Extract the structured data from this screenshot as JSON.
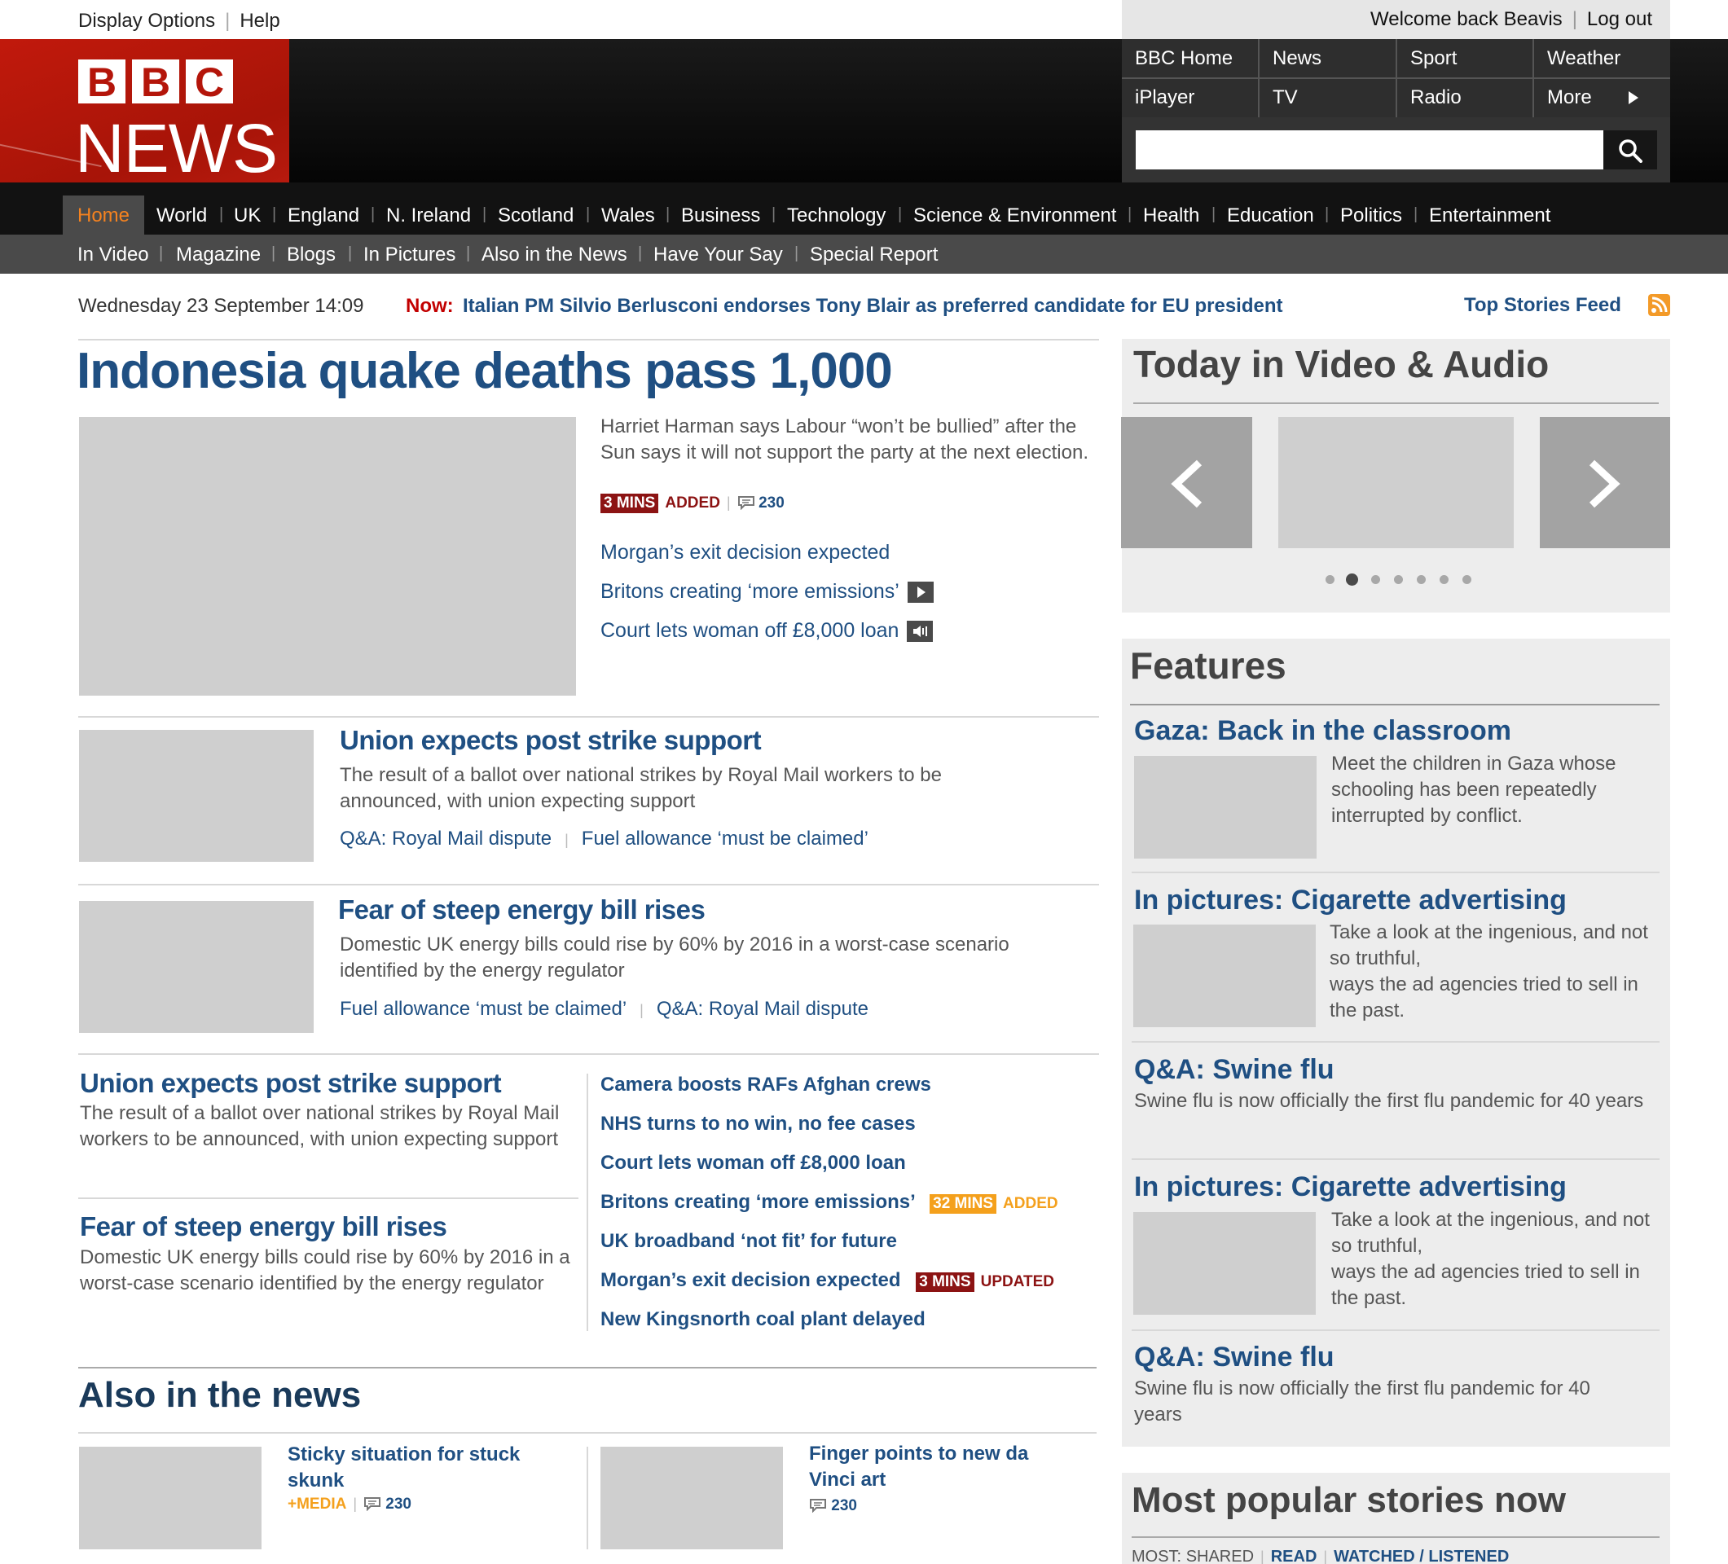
{
  "utility": {
    "display_options": "Display Options",
    "help": "Help",
    "sep": "|",
    "welcome": "Welcome back Beavis",
    "logout": "Log out"
  },
  "logo": {
    "letters": [
      "B",
      "B",
      "C"
    ],
    "news": "NEWS"
  },
  "global_nav": {
    "row1": [
      "BBC Home",
      "News",
      "Sport",
      "Weather"
    ],
    "row2": [
      "iPlayer",
      "TV",
      "Radio",
      "More"
    ]
  },
  "search": {
    "value": "",
    "placeholder": ""
  },
  "primary_nav": [
    "Home",
    "World",
    "UK",
    "England",
    "N. Ireland",
    "Scotland",
    "Wales",
    "Business",
    "Technology",
    "Science & Environment",
    "Health",
    "Education",
    "Politics",
    "Entertainment"
  ],
  "secondary_nav": [
    "In Video",
    "Magazine",
    "Blogs",
    "In Pictures",
    "Also in the News",
    "Have Your Say",
    "Special Report"
  ],
  "ticker": {
    "date": "Wednesday 23 September 14:09",
    "now_label": "Now:",
    "headline": "Italian PM Silvio Berlusconi endorses Tony Blair as preferred candidate for EU president",
    "feed_label": "Top Stories Feed"
  },
  "lead": {
    "title": "Indonesia quake deaths pass 1,000",
    "summary": "Harriet Harman says Labour “won’t be bullied” after the Sun says it will not support the party at the next election.",
    "badge": "3 MINS",
    "tag": "ADDED",
    "comments": "230",
    "related": [
      "Morgan’s exit decision expected",
      "Britons creating ‘more emissions’",
      "Court lets woman off £8,000 loan"
    ]
  },
  "stories": [
    {
      "title": "Union expects post strike support",
      "summary": "The result of a ballot over national strikes by Royal Mail workers to be announced, with union expecting support",
      "links": [
        "Q&A: Royal Mail dispute",
        "Fuel allowance ‘must be claimed’"
      ]
    },
    {
      "title": "Fear of steep energy bill rises",
      "summary": "Domestic UK energy bills could rise by 60% by 2016 in a worst-case scenario identified by the energy regulator",
      "links": [
        "Fuel allowance ‘must be claimed’",
        "Q&A: Royal Mail dispute"
      ]
    }
  ],
  "small_stories": [
    {
      "title": "Union expects post strike support",
      "summary": "The result of a ballot over national strikes by Royal Mail workers to be announced, with union expecting support"
    },
    {
      "title": "Fear of steep energy bill rises",
      "summary": "Domestic UK energy bills could rise by 60% by 2016 in a worst-case scenario identified by the energy regulator"
    }
  ],
  "headline_list": [
    {
      "text": "Camera boosts RAFs Afghan crews"
    },
    {
      "text": "NHS turns to no win, no fee cases"
    },
    {
      "text": "Court lets woman off £8,000 loan"
    },
    {
      "text": "Britons creating ‘more emissions’",
      "badge": "32 MINS",
      "tag": "ADDED",
      "color": "orange"
    },
    {
      "text": "UK broadband ‘not fit’ for future"
    },
    {
      "text": "Morgan’s exit decision expected",
      "badge": "3 MINS",
      "tag": "UPDATED",
      "color": "red"
    },
    {
      "text": "New Kingsnorth coal plant delayed"
    }
  ],
  "also_in_news": {
    "title": "Also in the news",
    "items": [
      {
        "title": "Sticky situation for stuck skunk",
        "media": "+MEDIA",
        "comments": "230"
      },
      {
        "title": "Finger points to new da Vinci art",
        "comments": "230"
      }
    ]
  },
  "video_panel": {
    "title": "Today in Video & Audio",
    "dots": 7,
    "active_dot": 2
  },
  "features": {
    "title": "Features",
    "items": [
      {
        "title": "Gaza: Back in the classroom",
        "text": "Meet the children in Gaza whose schooling has been repeatedly interrupted by conflict."
      },
      {
        "title": "In pictures: Cigarette advertising",
        "text_lines": [
          "Take a look at the ingenious, and not so truthful,",
          "ways the ad agencies tried to sell in the past."
        ]
      },
      {
        "title": "Q&A: Swine flu",
        "text": "Swine flu  is now officially the first flu pandemic for 40 years"
      },
      {
        "title": "In pictures: Cigarette advertising",
        "text_lines": [
          "Take a look at the ingenious, and not so truthful,",
          "ways the ad agencies tried to sell in the past."
        ]
      },
      {
        "title": "Q&A: Swine flu",
        "text": "Swine flu  is now officially the first flu pandemic for 40 years"
      }
    ]
  },
  "most_popular": {
    "title": "Most popular stories now",
    "tabs_label": "MOST:",
    "tabs": [
      "SHARED",
      "READ",
      "WATCHED / LISTENED"
    ]
  },
  "colors": {
    "brand_red": "#b4150a",
    "link_blue": "#1f4f82",
    "home_orange": "#f5821f",
    "badge_red": "#8c1313",
    "badge_orange": "#f4a01c"
  }
}
